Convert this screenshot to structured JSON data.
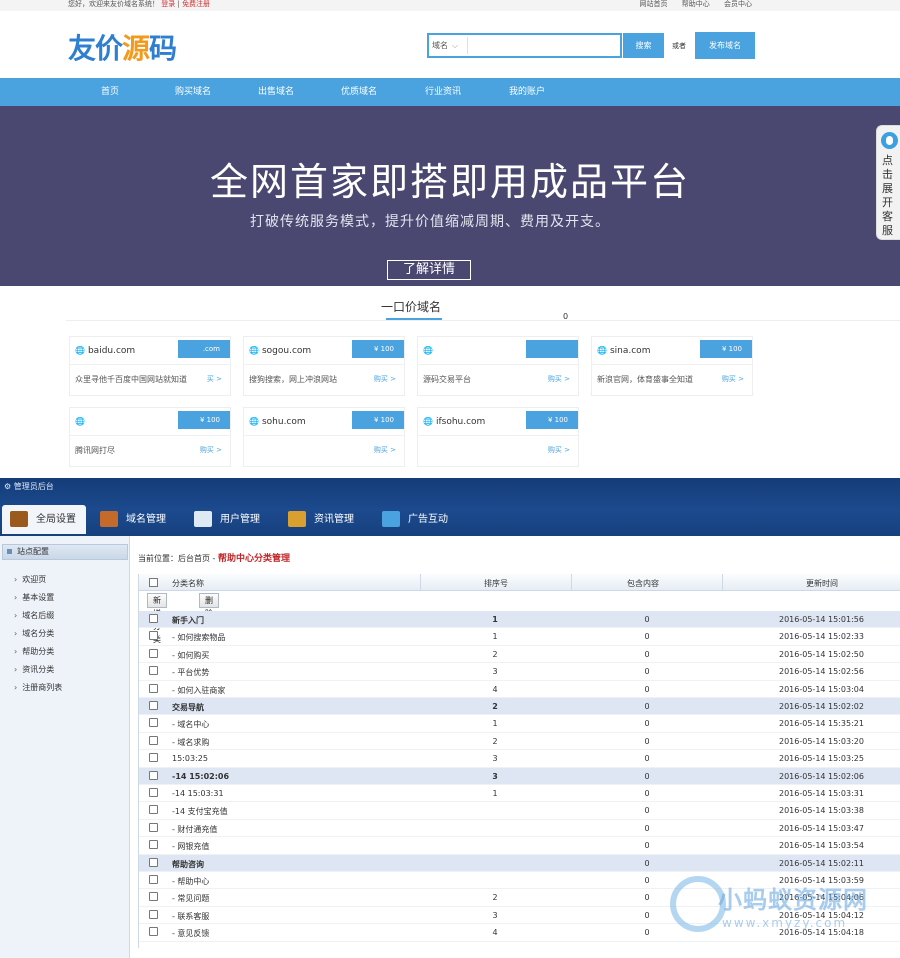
{
  "topbar": {
    "welcome": "您好，欢迎来友价域名系统！",
    "login": "登录",
    "separator": "|",
    "register": "免费注册",
    "links": [
      "网站首页",
      "帮助中心",
      "会员中心"
    ]
  },
  "header": {
    "logo": [
      "友价",
      "源",
      "码"
    ],
    "search_type": "域名",
    "search_placeholder": "",
    "search_button": "搜索",
    "or_text": "或者",
    "publish_button": "发布域名"
  },
  "nav": [
    "首页",
    "购买域名",
    "出售域名",
    "优质域名",
    "行业资讯",
    "我的账户"
  ],
  "banner": {
    "title": "全网首家即搭即用成品平台",
    "subtitle": "打破传统服务模式，提升价值缩减周期、费用及开支。",
    "button": "了解详情"
  },
  "service_tab": "点击展开客服",
  "section": {
    "title": "一口价域名",
    "count": "0"
  },
  "domain_cards": [
    {
      "name": "baidu.com",
      "price": ".com",
      "desc": "众里寻他千百度中国网站就知道",
      "buy": "买 >"
    },
    {
      "name": "sogou.com",
      "price": "¥ 100",
      "desc": "搜狗搜索，网上冲浪网站",
      "buy": "购买 >"
    },
    {
      "name": "",
      "price": "",
      "desc": "源码交易平台",
      "buy": "购买 >"
    },
    {
      "name": "sina.com",
      "price": "¥ 100",
      "desc": "新浪官网，体育盛事全知道",
      "buy": "购买 >"
    },
    {
      "name": "",
      "price": "¥ 100",
      "desc": "腾讯网打尽",
      "buy": "购买 >"
    },
    {
      "name": "sohu.com",
      "price": "¥ 100",
      "desc": "",
      "buy": "购买 >"
    },
    {
      "name": "ifsohu.com",
      "price": "¥ 100",
      "desc": "",
      "buy": "购买 >"
    }
  ],
  "admin": {
    "brand": "管理员后台",
    "tabs": [
      "全局设置",
      "域名管理",
      "用户管理",
      "资讯管理",
      "广告互动"
    ],
    "sidebar_title": "站点配置",
    "sidebar_items": [
      "欢迎页",
      "基本设置",
      "域名后缀",
      "域名分类",
      "帮助分类",
      "资讯分类",
      "注册商列表"
    ],
    "breadcrumb": {
      "prefix": "当前位置：后台首页 - ",
      "current": "帮助中心分类管理"
    },
    "columns": [
      "分类名称",
      "排序号",
      "包含内容",
      "更新时间"
    ],
    "buttons": {
      "add": "新增分类",
      "delete": "删除"
    },
    "rows": [
      {
        "name": "新手入门",
        "sort": "1",
        "count": "0",
        "time": "2016-05-14 15:01:56",
        "group": true
      },
      {
        "name": "- 如何搜索物品",
        "sort": "1",
        "count": "0",
        "time": "2016-05-14 15:02:33",
        "group": false
      },
      {
        "name": "- 如何购买",
        "sort": "2",
        "count": "0",
        "time": "2016-05-14 15:02:50",
        "group": false
      },
      {
        "name": "- 平台优势",
        "sort": "3",
        "count": "0",
        "time": "2016-05-14 15:02:56",
        "group": false
      },
      {
        "name": "- 如何入驻商家",
        "sort": "4",
        "count": "0",
        "time": "2016-05-14 15:03:04",
        "group": false
      },
      {
        "name": "交易导航",
        "sort": "2",
        "count": "0",
        "time": "2016-05-14 15:02:02",
        "group": true
      },
      {
        "name": "- 域名中心",
        "sort": "1",
        "count": "0",
        "time": "2016-05-14 15:35:21",
        "group": false
      },
      {
        "name": "- 域名求购",
        "sort": "2",
        "count": "0",
        "time": "2016-05-14 15:03:20",
        "group": false
      },
      {
        "name": "15:03:25",
        "sort": "3",
        "count": "0",
        "time": "2016-05-14 15:03:25",
        "group": false
      },
      {
        "name": "-14 15:02:06",
        "sort": "3",
        "count": "0",
        "time": "2016-05-14 15:02:06",
        "group": true
      },
      {
        "name": "-14 15:03:31",
        "sort": "1",
        "count": "0",
        "time": "2016-05-14 15:03:31",
        "group": false
      },
      {
        "name": "-14 支付宝充值",
        "sort": "",
        "count": "0",
        "time": "2016-05-14 15:03:38",
        "group": false
      },
      {
        "name": "- 财付通充值",
        "sort": "",
        "count": "0",
        "time": "2016-05-14 15:03:47",
        "group": false
      },
      {
        "name": "- 网银充值",
        "sort": "",
        "count": "0",
        "time": "2016-05-14 15:03:54",
        "group": false
      },
      {
        "name": "帮助咨询",
        "sort": "",
        "count": "0",
        "time": "2016-05-14 15:02:11",
        "group": true
      },
      {
        "name": "- 帮助中心",
        "sort": "",
        "count": "0",
        "time": "2016-05-14 15:03:59",
        "group": false
      },
      {
        "name": "- 常见问题",
        "sort": "2",
        "count": "0",
        "time": "2016-05-14 15:04:06",
        "group": false
      },
      {
        "name": "- 联系客服",
        "sort": "3",
        "count": "0",
        "time": "2016-05-14 15:04:12",
        "group": false
      },
      {
        "name": "- 意见反馈",
        "sort": "4",
        "count": "0",
        "time": "2016-05-14 15:04:18",
        "group": false
      }
    ]
  },
  "watermark": {
    "text": "小蚂蚁资源网",
    "url": "www.xmyzy.com"
  },
  "colors": {
    "accent": "#4aa3df",
    "banner": "#4a4870",
    "admin_header": "#1c4a8e",
    "breadcrumb_current": "#c0282a"
  }
}
